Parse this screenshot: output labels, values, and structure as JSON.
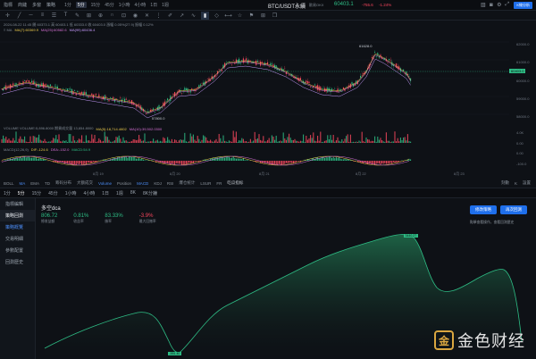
{
  "topbar": {
    "items": [
      "指標",
      "商鏈",
      "多窗",
      "策略"
    ],
    "timeframes": [
      "1分",
      "5分",
      "15分",
      "45分",
      "1小時",
      "4小時",
      "1日",
      "1週"
    ],
    "active_tf": "5分",
    "symbol": "BTC/USDT永續",
    "exchange": "歐易OKX",
    "price": "60403.1",
    "change": "-755.6",
    "change_pct": "-1.24%",
    "kbtn": "K線分析"
  },
  "info": {
    "line1": "2024-08-22 11:45  開 60373.1  高 60403.1  低 60333.0  收 60403.0  漲幅 0.05%(27.9)  振幅 0.12%",
    "ma7": "MA(7):60369.9",
    "ma25": "MA(25):60582.6",
    "ma99": "MA(99):60436.4",
    "volume": "VOLUME  VOLUME:5,896.8000  期貨成交量 13,854.8000",
    "vol_ma5": "MA(5):18,714.4602",
    "vol_ma10": "MA(10):39,502.0300",
    "macd": "MACD(12,26,9)",
    "dif": "DIF:-124.6",
    "dea": "DEA:-152.0",
    "macd_val": "MACD:54.9",
    "high_label": "61628.0",
    "low_label": "57800.0",
    "right_price": "60403.0"
  },
  "y_axis": [
    "62000.0",
    "61000.0",
    "60000.0",
    "59000.0",
    "58000.0",
    "57000.0"
  ],
  "vol_axis": [
    "0.00",
    "4.0K"
  ],
  "macd_axis": [
    "0.00",
    "-100.0",
    "-200.0"
  ],
  "x_axis": [
    "8月 19",
    "8月 20",
    "8月 21",
    "8月 22",
    "8月 23"
  ],
  "indicators": [
    "BOLL",
    "MA",
    "EMA",
    "TD",
    "筹码分布",
    "大额成交",
    "Volume",
    "Position",
    "MACD",
    "KDJ",
    "RSI",
    "爆仓统计",
    "LSUR",
    "FR",
    "吃瓜指标"
  ],
  "indicators_right": [
    "刻數",
    "K",
    "設置"
  ],
  "tabs": [
    "1分",
    "5分",
    "15分",
    "45分",
    "1小時",
    "4小時",
    "1日",
    "1週",
    "8K",
    "8K分鐘"
  ],
  "sidebar": {
    "head1": "指標編輯",
    "head2": "策略回測",
    "items": [
      "策略概覽",
      "交易明細",
      "參數配置",
      "回測歷史"
    ]
  },
  "strategy": {
    "name": "多空dca",
    "stats": [
      {
        "value": "806.72",
        "label": "總收益額",
        "color": "#2ebd85"
      },
      {
        "value": "0.81%",
        "label": "收益率",
        "color": "#2ebd85"
      },
      {
        "value": "83.33%",
        "label": "勝率",
        "color": "#2ebd85"
      },
      {
        "value": "-3.9%",
        "label": "最大回撤率",
        "color": "#f6465d"
      }
    ],
    "btn1": "修改策略",
    "btn2": "再次回測",
    "note": "點擊查看操作，查看回測歷史",
    "peak_label": "3440.27",
    "trough_label": "-551.40"
  },
  "watermark": {
    "logo": "金",
    "text": "金色财经"
  }
}
